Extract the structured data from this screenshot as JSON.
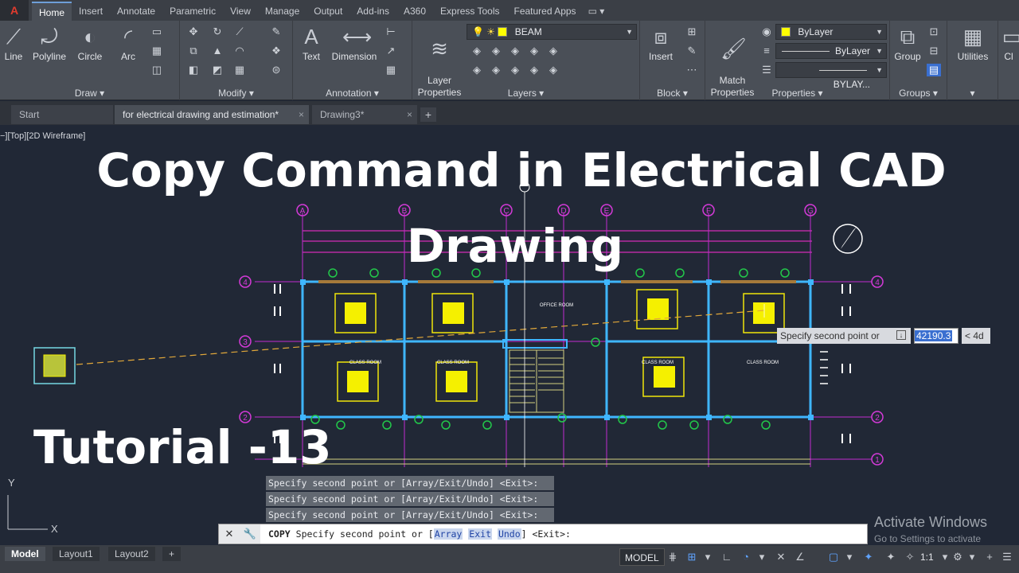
{
  "ribbon_tabs": [
    "Home",
    "Insert",
    "Annotate",
    "Parametric",
    "View",
    "Manage",
    "Output",
    "Add-ins",
    "A360",
    "Express Tools",
    "Featured Apps"
  ],
  "ribbon": {
    "draw": {
      "title": "Draw",
      "line": "Line",
      "polyline": "Polyline",
      "circle": "Circle",
      "arc": "Arc"
    },
    "modify": {
      "title": "Modify"
    },
    "annotation": {
      "title": "Annotation",
      "text": "Text",
      "dimension": "Dimension"
    },
    "layers": {
      "title": "Layers",
      "layer_properties": "Layer\nProperties",
      "current_layer": "BEAM"
    },
    "block": {
      "title": "Block",
      "insert": "Insert"
    },
    "properties": {
      "title": "Properties",
      "match_properties": "Match\nProperties",
      "color": "ByLayer",
      "linetype": "ByLayer",
      "lineweight": "BYLAY..."
    },
    "groups": {
      "title": "Groups",
      "group": "Group"
    },
    "utilities": {
      "label": "Utilities"
    },
    "clipboard_cut": "Cl"
  },
  "file_tabs": {
    "start": "Start",
    "active": "for electrical drawing and estimation*",
    "other": "Drawing3*"
  },
  "viewport_label": "−][Top][2D Wireframe]",
  "overlay": {
    "title_line1": "Copy Command in Electrical CAD",
    "title_line2": "Drawing",
    "subtitle": "Tutorial -13"
  },
  "tooltip": {
    "prompt": "Specify second point or",
    "value": "42190.3",
    "angle": "< 4d"
  },
  "command_history": [
    "Specify second point or [Array/Exit/Undo] <Exit>:",
    "Specify second point or [Array/Exit/Undo] <Exit>:",
    "Specify second point or [Array/Exit/Undo] <Exit>:"
  ],
  "command_line": {
    "command": "COPY",
    "prompt": "Specify second point or [",
    "opt1": "Array",
    "opt2": "Exit",
    "opt3": "Undo",
    "suffix": "] <Exit>:"
  },
  "watermark": {
    "title": "Activate Windows",
    "subtitle": "Go to Settings to activate"
  },
  "status": {
    "layout_tabs": [
      "Model",
      "Layout1",
      "Layout2"
    ],
    "model_button": "MODEL",
    "scale": "1:1"
  },
  "drawing": {
    "grid_columns": [
      "A",
      "B",
      "C",
      "D",
      "E",
      "F",
      "G"
    ],
    "grid_rows": [
      "4",
      "3",
      "2",
      "1"
    ],
    "room_labels": [
      "OFFICE ROOM",
      "CLASS ROOM",
      "CLASS ROOM",
      "CLASS ROOM",
      "CLASS ROOM"
    ],
    "ucs_x": "X",
    "ucs_y": "Y"
  }
}
